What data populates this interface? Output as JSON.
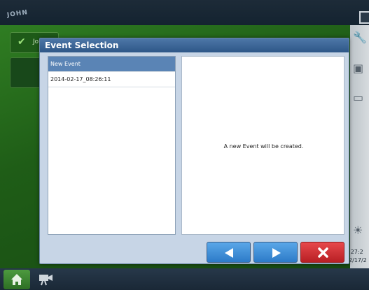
{
  "app": {
    "logo_text": "JOHN",
    "green_row_label": "Jo",
    "right_panel_times": [
      ":27:2",
      "2/17/2"
    ]
  },
  "dialog": {
    "title": "Event Selection",
    "list_items": [
      {
        "label": "New Event",
        "selected": true
      },
      {
        "label": "2014-02-17_08:26:11",
        "selected": false
      }
    ],
    "info_message": "A new Event will be created."
  },
  "buttons": {
    "prev_icon": "left-arrow-icon",
    "next_icon": "right-arrow-icon",
    "cancel_icon": "close-icon"
  },
  "colors": {
    "title_bar": "#2e5787",
    "selected_item": "#5a84b5",
    "nav_button": "#2d7bc8",
    "cancel_button": "#b81f24",
    "background_green": "#1f5d17"
  }
}
